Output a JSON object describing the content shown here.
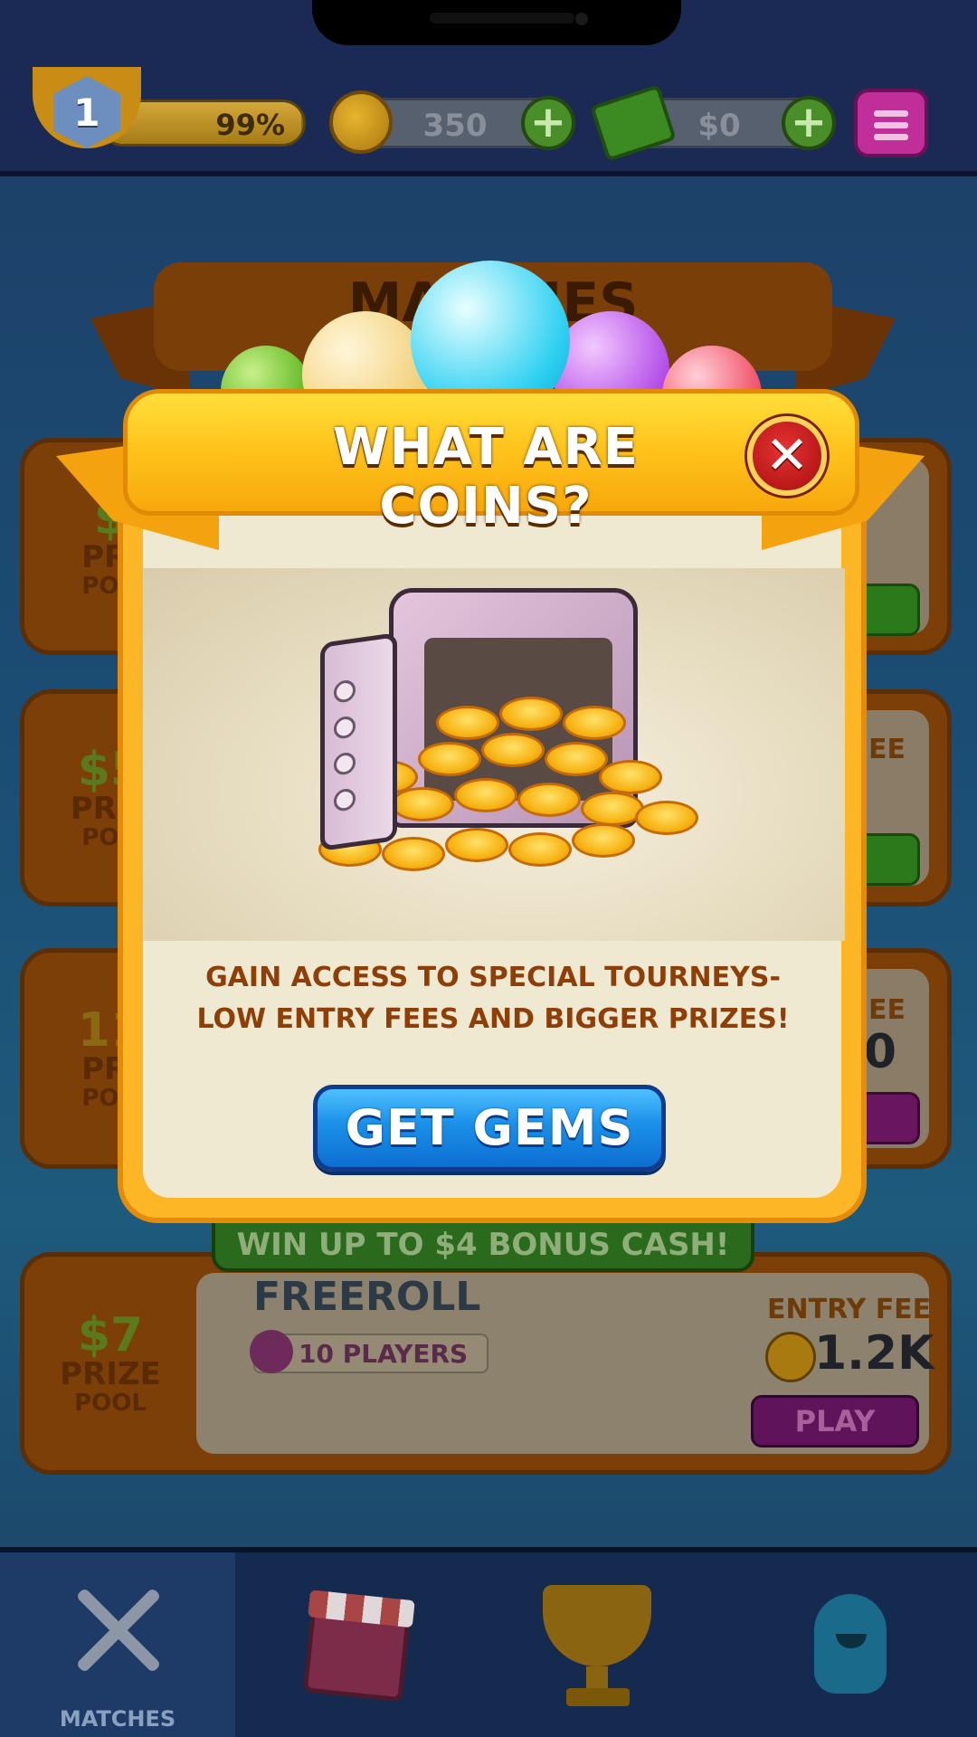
{
  "header": {
    "level": "1",
    "xp_percent_label": "99%",
    "xp_progress": 0.99,
    "coins": "350",
    "cash": "$0"
  },
  "background": {
    "section_title": "MATCHES",
    "cards": [
      {
        "prize": "$",
        "prize_label": "PRI",
        "pool_label": "POO"
      },
      {
        "prize": "$5",
        "prize_label": "PRIZ",
        "pool_label": "POO",
        "entry_label": "FEE"
      },
      {
        "prize": "11",
        "prize_label": "PRI",
        "pool_label": "POO",
        "entry_label": "FEE",
        "entry_value": "0"
      }
    ],
    "bonus_banner": "WIN UP TO $4 BONUS CASH!",
    "freeroll": {
      "prize": "$7",
      "prize_label": "PRIZE",
      "pool_label": "POOL",
      "title": "FREEROLL",
      "players": "10 PLAYERS",
      "entry_label": "ENTRY FEE",
      "entry_value": "1.2K",
      "play_label": "PLAY"
    }
  },
  "modal": {
    "title": "WHAT ARE COINS?",
    "close_label": "✕",
    "description_line1": "GAIN ACCESS TO SPECIAL TOURNEYS-",
    "description_line2": "LOW ENTRY FEES AND BIGGER PRIZES!",
    "cta_label": "GET GEMS"
  },
  "bottom_nav": {
    "tabs": [
      {
        "label": "MATCHES",
        "icon": "crossed-swords-icon",
        "active": true
      },
      {
        "label": "",
        "icon": "shop-icon"
      },
      {
        "label": "",
        "icon": "trophy-icon"
      },
      {
        "label": "",
        "icon": "avatar-icon"
      }
    ]
  },
  "colors": {
    "modal_ribbon": "#ffc21a",
    "modal_panel": "#efe9d2",
    "cta_blue": "#1a8fe8",
    "close_red": "#d42020",
    "description_text": "#8e3f08"
  }
}
